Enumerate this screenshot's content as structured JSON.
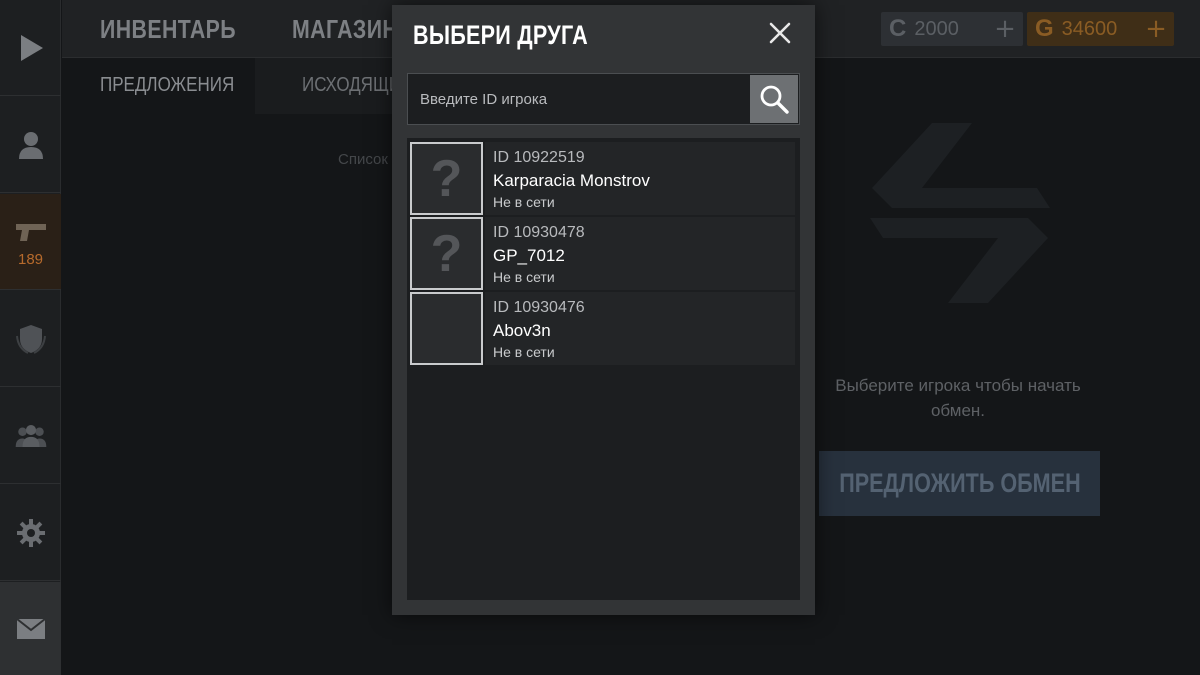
{
  "top_tabs": {
    "inventory": "ИНВЕНТАРЬ",
    "shop": "МАГАЗИН"
  },
  "sub_tabs": {
    "offers": "ПРЕДЛОЖЕНИЯ",
    "outgoing": "ИСХОДЯЩИ"
  },
  "background": {
    "list_hint": "Список",
    "trade_hint": "Выберите игрока чтобы начать обмен.",
    "offer_button": "ПРЕДЛОЖИТЬ ОБМЕН"
  },
  "sidebar": {
    "weapons_count": "189"
  },
  "currency": {
    "silver": {
      "symbol": "C",
      "value": "2000",
      "plus": "+"
    },
    "gold": {
      "symbol": "G",
      "value": "34600",
      "plus": "+"
    }
  },
  "modal": {
    "title": "ВЫБЕРИ ДРУГА",
    "search_placeholder": "Введите ID игрока",
    "friends": [
      {
        "id": "ID 10922519",
        "name": "Karparacia Monstrov",
        "status": "Не в сети",
        "avatar": "?"
      },
      {
        "id": "ID 10930478",
        "name": "GP_7012",
        "status": "Не в сети",
        "avatar": "?"
      },
      {
        "id": "ID 10930476",
        "name": "Abov3n",
        "status": "Не в сети",
        "avatar": ""
      }
    ]
  },
  "colors": {
    "modal_bg": "#323436",
    "list_bg": "#1c1e20",
    "gold": "#8a5c24",
    "offer_button": "#27313d"
  },
  "icons": [
    "play-icon",
    "profile-icon",
    "pistol-icon",
    "clan-emblem-icon",
    "friends-icon",
    "gear-icon",
    "mail-icon",
    "close-icon",
    "search-icon",
    "trade-arrows-icon"
  ]
}
